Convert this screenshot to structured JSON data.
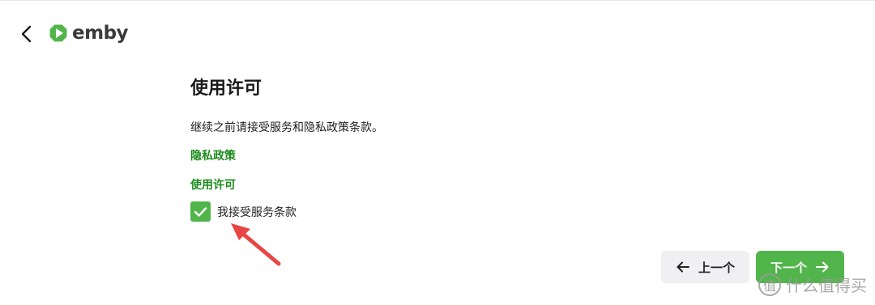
{
  "header": {
    "back_icon": "chevron-left-icon",
    "logo_text": "emby",
    "brand_color": "#52b54b"
  },
  "main": {
    "title": "使用许可",
    "description": "继续之前请接受服务和隐私政策条款。",
    "privacy_link": "隐私政策",
    "license_link": "使用许可",
    "accept_checkbox": {
      "label": "我接受服务条款",
      "checked": true
    }
  },
  "footer": {
    "prev_label": "上一个",
    "next_label": "下一个",
    "prev_icon": "arrow-left-icon",
    "next_icon": "arrow-right-icon"
  },
  "annotation": {
    "arrow_color": "#e84545"
  },
  "watermark": {
    "badge": "值",
    "text": "什么值得买"
  }
}
